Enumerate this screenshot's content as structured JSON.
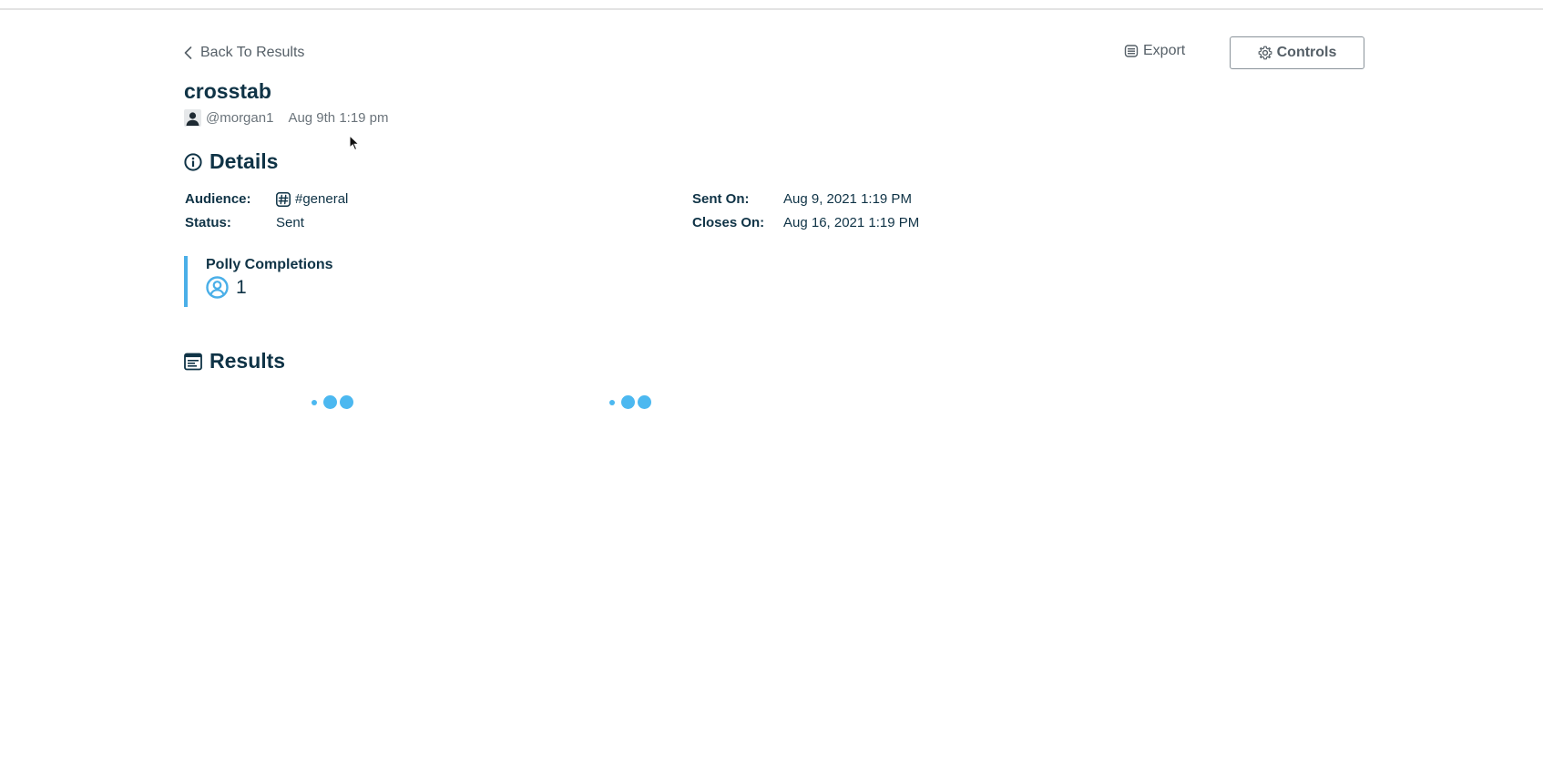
{
  "nav": {
    "back_label": "Back To Results",
    "export_label": "Export",
    "controls_label": "Controls"
  },
  "poll": {
    "title": "crosstab",
    "author": "@morgan1",
    "created": "Aug 9th 1:19 pm"
  },
  "details": {
    "heading": "Details",
    "audience_label": "Audience:",
    "audience_value": "#general",
    "status_label": "Status:",
    "status_value": "Sent",
    "sent_on_label": "Sent On:",
    "sent_on_value": "Aug 9, 2021 1:19 PM",
    "closes_on_label": "Closes On:",
    "closes_on_value": "Aug 16, 2021 1:19 PM"
  },
  "completions": {
    "label": "Polly Completions",
    "count": "1"
  },
  "results": {
    "heading": "Results"
  },
  "icons": {
    "back": "chevron-left-icon",
    "export": "export-icon",
    "controls": "gear-icon",
    "user": "user-icon",
    "details": "info-circle-icon",
    "audience": "hashtag-channel-icon",
    "completions": "user-circle-icon",
    "results": "results-panel-icon"
  },
  "colors": {
    "primary_text": "#0f3346",
    "muted_text": "#555f67",
    "accent": "#4aafe8",
    "loader": "#4cb8f0",
    "divider": "#e3e3e3"
  }
}
